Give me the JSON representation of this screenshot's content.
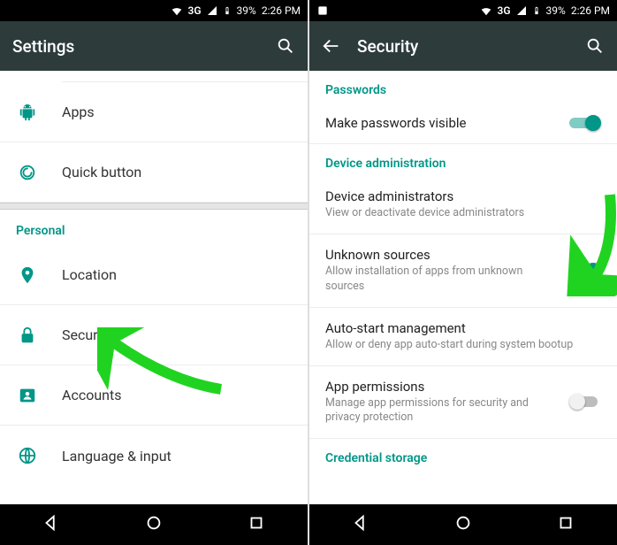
{
  "colors": {
    "accent": "#009688",
    "appbar": "#2d3b3b"
  },
  "status": {
    "network": "3G",
    "battery": "39%",
    "time": "2:26 PM"
  },
  "left": {
    "title": "Settings",
    "items_top": [
      {
        "key": "apps",
        "label": "Apps"
      },
      {
        "key": "quick",
        "label": "Quick button"
      }
    ],
    "section": "Personal",
    "items_personal": [
      {
        "key": "location",
        "label": "Location"
      },
      {
        "key": "security",
        "label": "Security"
      },
      {
        "key": "accounts",
        "label": "Accounts"
      },
      {
        "key": "language",
        "label": "Language & input"
      }
    ]
  },
  "right": {
    "title": "Security",
    "sections": {
      "passwords": {
        "header": "Passwords",
        "row": {
          "title": "Make passwords visible",
          "on": true
        }
      },
      "device_admin": {
        "header": "Device administration",
        "rows": [
          {
            "key": "admins",
            "title": "Device administrators",
            "sub": "View or deactivate device administrators"
          },
          {
            "key": "unknown",
            "title": "Unknown sources",
            "sub": "Allow installation of apps from unknown sources",
            "toggle": true,
            "on": true
          },
          {
            "key": "autostart",
            "title": "Auto-start management",
            "sub": "Allow or deny app auto-start during system bootup"
          },
          {
            "key": "perms",
            "title": "App permissions",
            "sub": "Manage app permissions for security and privacy protection",
            "toggle": true,
            "on": false
          }
        ]
      },
      "credential": {
        "header": "Credential storage"
      }
    }
  }
}
